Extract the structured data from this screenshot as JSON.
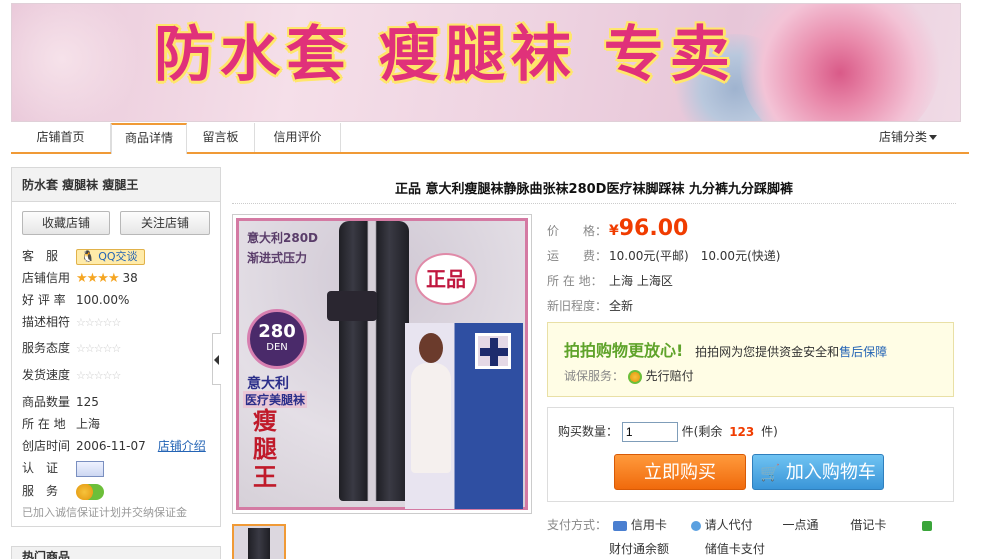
{
  "banner": {
    "title": "防水套 瘦腿袜 专卖"
  },
  "nav": {
    "tabs": [
      {
        "label": "店铺首页"
      },
      {
        "label": "商品详情"
      },
      {
        "label": "留言板"
      },
      {
        "label": "信用评价"
      }
    ],
    "category_label": "店铺分类"
  },
  "shop": {
    "name": "防水套 瘦腿袜 瘦腿王",
    "favorite_button": "收藏店铺",
    "follow_button": "关注店铺",
    "service_key": "客　服",
    "qq_label": "QQ交谈",
    "credit_key": "店铺信用",
    "credit_value": "38",
    "rating_key": "好 评 率",
    "rating_value": "100.00%",
    "desc_key": "描述相符",
    "attitude_key": "服务态度",
    "speed_key": "发货速度",
    "count_key": "商品数量",
    "count_value": "125",
    "location_key": "所 在 地",
    "location_value": "上海",
    "created_key": "创店时间",
    "created_value": "2006-11-07",
    "intro_link": "店铺介绍",
    "cert_key": "认　证",
    "svc_key": "服　务",
    "guarantee_note": "已加入诚信保证计划并交纳保证金",
    "next_section": "热门商品"
  },
  "product": {
    "title": "正品 意大利瘦腿袜静脉曲张袜280D医疗袜脚踩袜 九分裤九分踩脚裤",
    "image_texts": {
      "brand": "意大利280D",
      "sub": "渐进式压力",
      "badge_top": "280",
      "badge_bottom": "DEN",
      "authentic": "正品",
      "made": "意大利",
      "medical": "医疗美腿袜",
      "slim": "瘦腿王"
    },
    "price_key": "价　　格：",
    "currency": "¥",
    "price": "96.00",
    "shipping_key": "运　　费：",
    "shipping_value": "10.00元(平邮)　10.00元(快递)",
    "location_key": "所 在 地：",
    "location_value": "上海 上海区",
    "condition_key": "新旧程度：",
    "condition_value": "全新"
  },
  "assurance": {
    "headline": "拍拍购物更放心!",
    "desc": "拍拍网为您提供资金安全和",
    "link": "售后保障",
    "service_key": "诚保服务：",
    "service_value": "先行赔付"
  },
  "purchase": {
    "qty_label": "购买数量：",
    "qty_value": "1",
    "stock_prefix": "件(剩余",
    "stock_value": "123",
    "stock_suffix": "件)",
    "buy_now": "立即购买",
    "add_cart": "加入购物车"
  },
  "payment": {
    "label": "支付方式：",
    "methods": [
      "信用卡",
      "请人代付",
      "一点通",
      "借记卡",
      "财付通余额",
      "储值卡支付"
    ]
  },
  "colors": {
    "accent": "#f09a36",
    "price": "#f03c00",
    "link": "#2464b5",
    "banner_text": "#e0317a"
  }
}
